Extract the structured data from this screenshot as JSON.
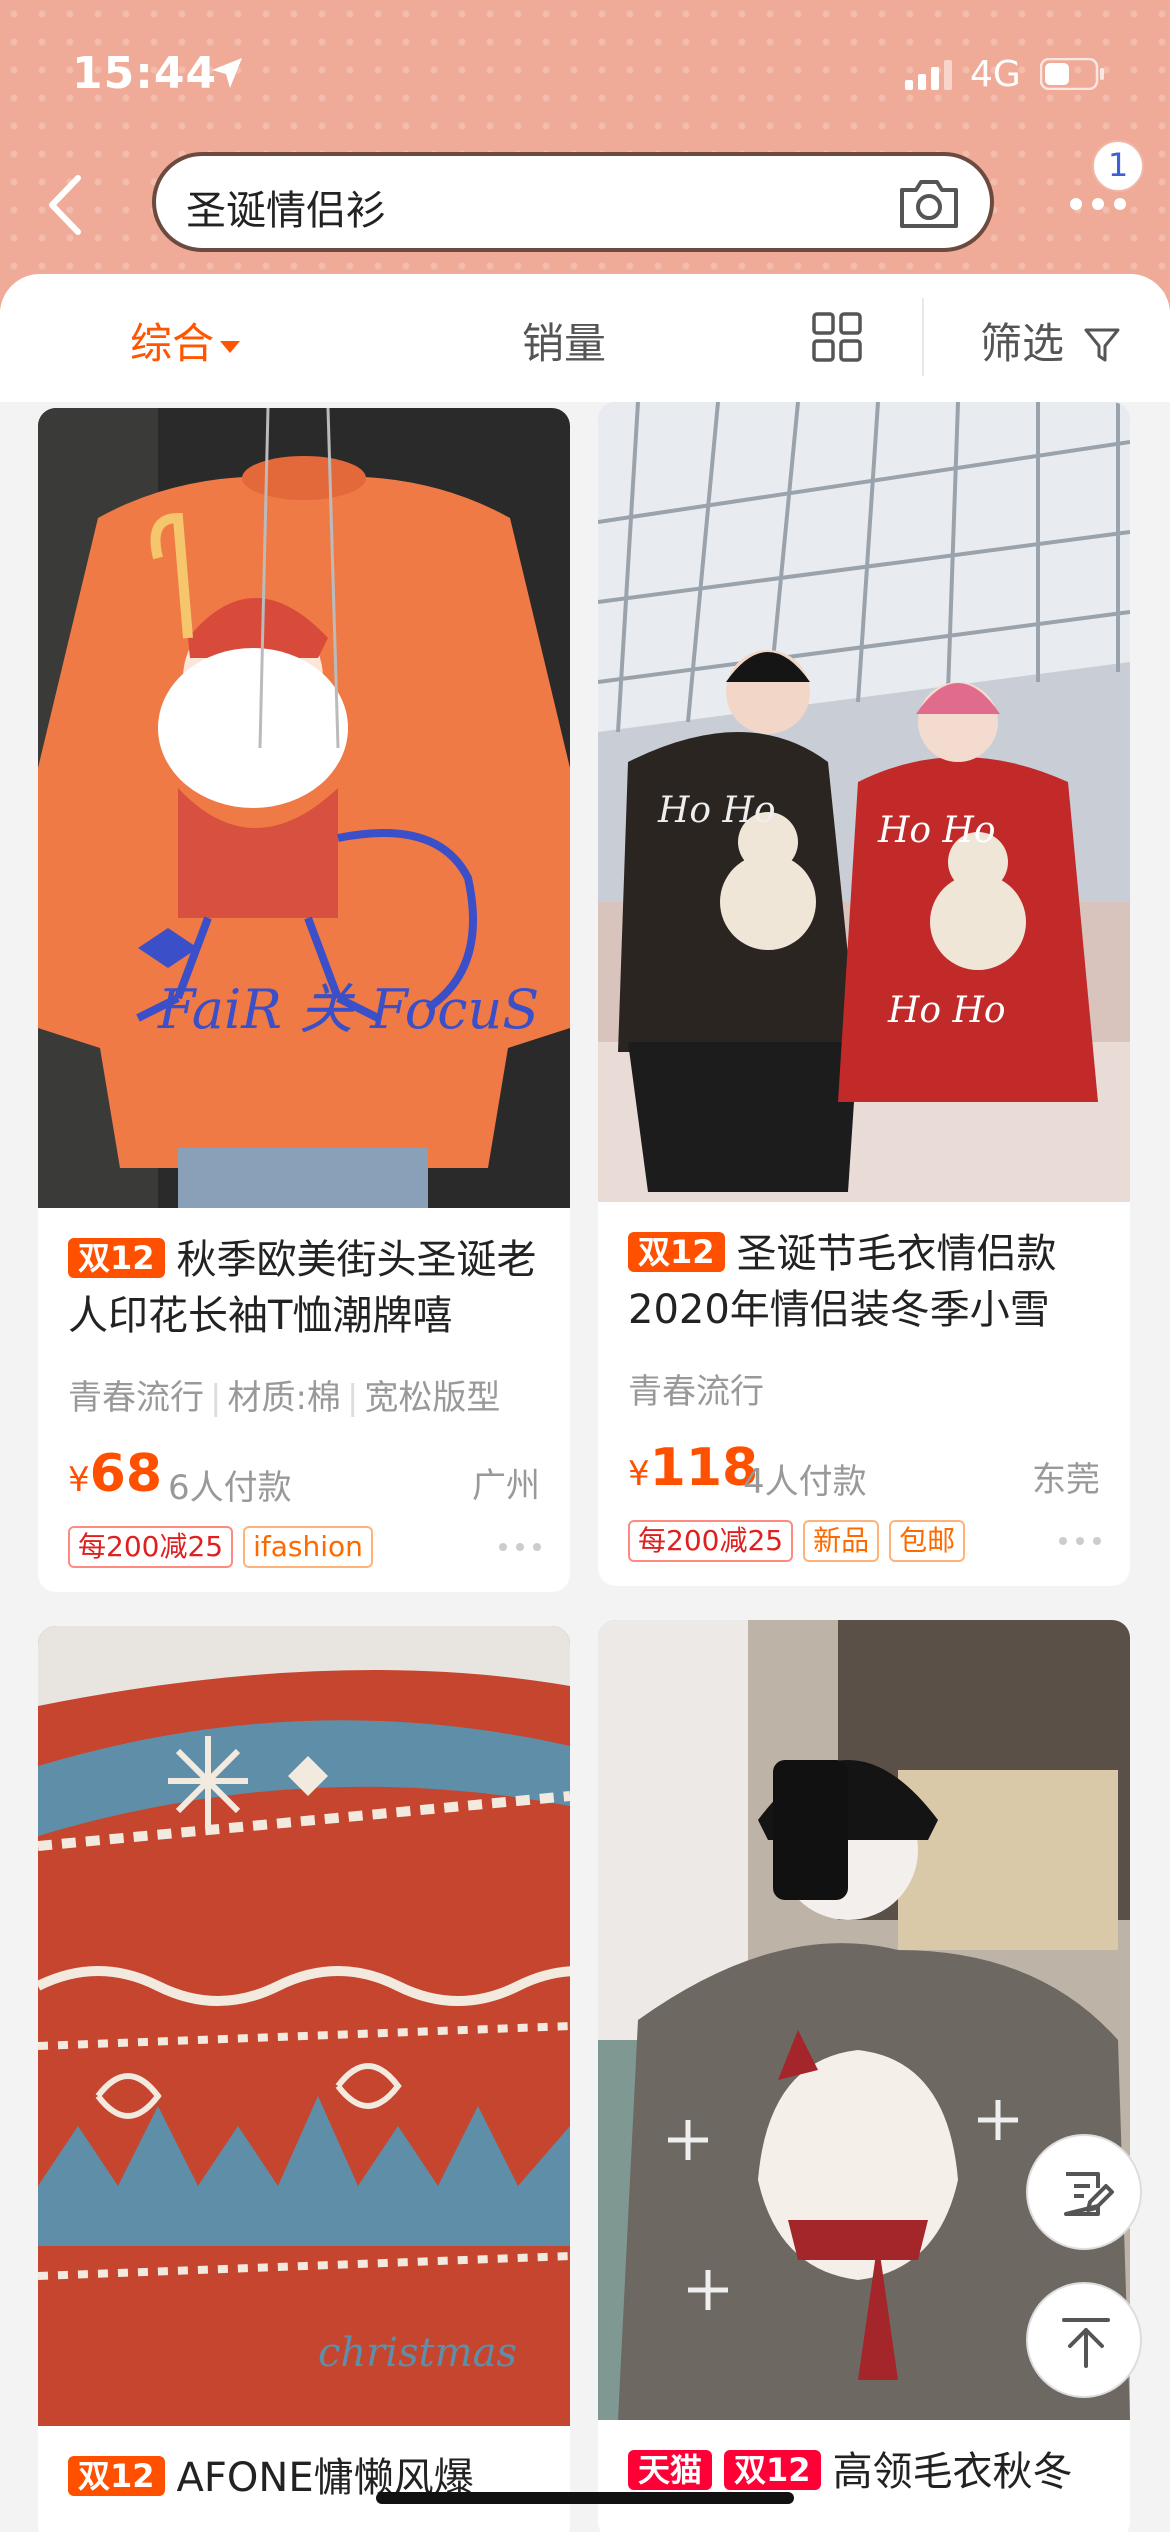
{
  "status_bar": {
    "time": "15:44",
    "network": "4G"
  },
  "search": {
    "query": "圣诞情侣衫"
  },
  "notification_count": "1",
  "sort_bar": {
    "comprehensive": "综合",
    "sales": "销量",
    "filter": "筛选"
  },
  "products": [
    {
      "badge": "双12",
      "title": "秋季欧美街头圣诞老人印花长袖T恤潮牌嘻",
      "attributes": [
        "青春流行",
        "材质:棉",
        "宽松版型"
      ],
      "currency": "¥",
      "price": "68",
      "sales": "6人付款",
      "location": "广州",
      "promos": [
        "每200减25",
        "ifashion"
      ]
    },
    {
      "badge": "双12",
      "title": "圣诞节毛衣情侣款2020年情侣装冬季小雪",
      "attributes": [
        "青春流行"
      ],
      "currency": "¥",
      "price": "118",
      "sales": "4人付款",
      "location": "东莞",
      "promos": [
        "每200减25",
        "新品",
        "包邮"
      ]
    },
    {
      "badge": "双12",
      "title": "AFONE慵懒风爆"
    },
    {
      "badge_tmall": "天猫",
      "badge": "双12",
      "title": "高领毛衣秋冬"
    }
  ],
  "colors": {
    "accent": "#ff5500",
    "header": "#efab97",
    "price": "#ff5000"
  },
  "icons": [
    "back-icon",
    "camera-icon",
    "more-icon",
    "grid-view-icon",
    "filter-icon",
    "edit-icon",
    "back-to-top-icon"
  ]
}
